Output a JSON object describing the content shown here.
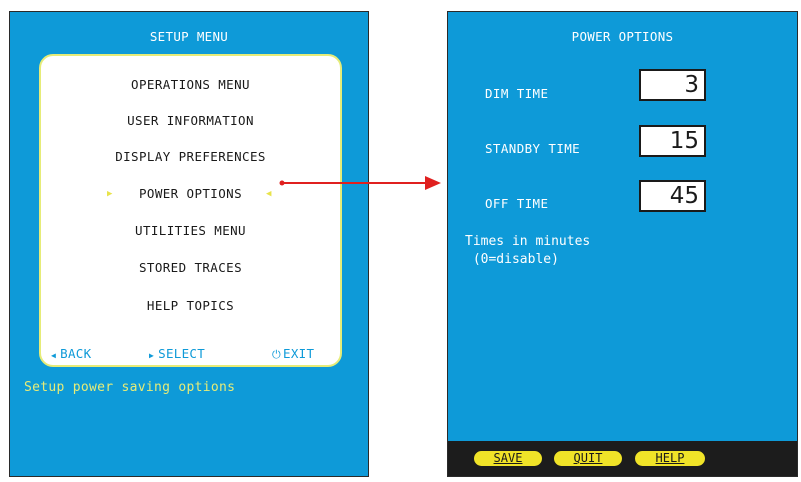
{
  "setup_menu": {
    "title": "SETUP MENU",
    "items": [
      {
        "label": "OPERATIONS MENU"
      },
      {
        "label": "USER INFORMATION"
      },
      {
        "label": "DISPLAY PREFERENCES"
      },
      {
        "label": "POWER OPTIONS",
        "selected": true
      },
      {
        "label": "UTILITIES MENU"
      },
      {
        "label": "STORED TRACES"
      },
      {
        "label": "HELP TOPICS"
      }
    ],
    "footer": {
      "back": "BACK",
      "select": "SELECT",
      "exit": "EXIT"
    },
    "status": "Setup power saving options"
  },
  "power_options": {
    "title": "POWER OPTIONS",
    "fields": [
      {
        "label": "DIM TIME",
        "value": "3"
      },
      {
        "label": "STANDBY TIME",
        "value": "15"
      },
      {
        "label": "OFF TIME",
        "value": "45"
      }
    ],
    "note_line1": "Times in minutes",
    "note_line2": " (0=disable)",
    "buttons": {
      "save": "SAVE",
      "quit": "QUIT",
      "help": "HELP"
    }
  },
  "colors": {
    "screen_bg": "#0e9ad8",
    "highlight": "#e6ec78",
    "button_bg": "#f0e328",
    "bar_bg": "#1c1c1c",
    "arrow": "#e0201f"
  },
  "icons": {
    "selection_marker": "triangle-icon",
    "back": "left-triangle-icon",
    "select": "right-triangle-icon",
    "exit": "power-icon",
    "connector": "arrow-right-icon"
  }
}
